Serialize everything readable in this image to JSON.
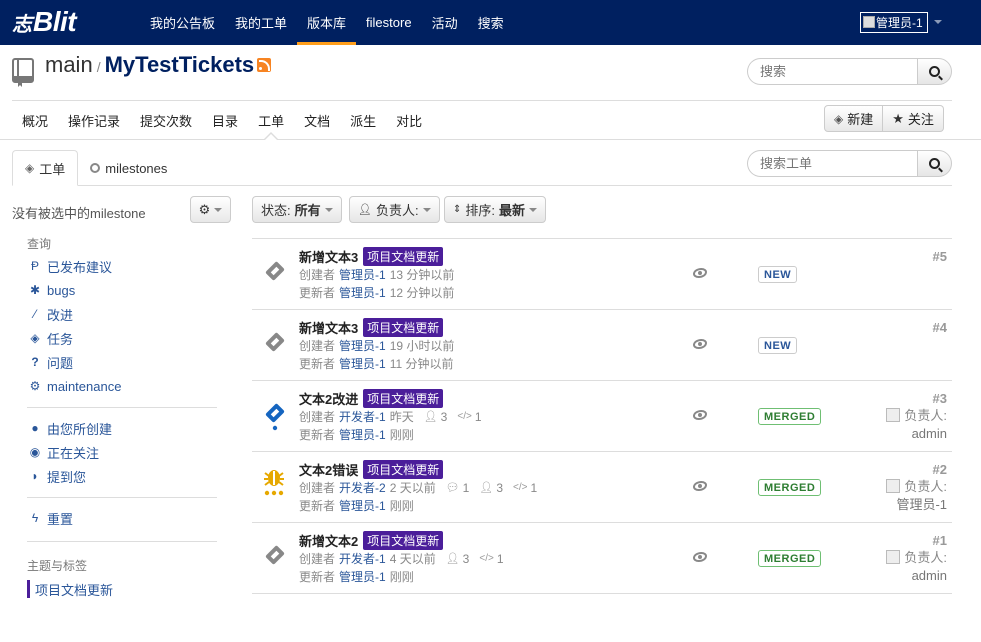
{
  "brand": {
    "prefix": "志",
    "name": "Blit"
  },
  "nav": [
    "我的公告板",
    "我的工单",
    "版本库",
    "filestore",
    "活动",
    "搜索"
  ],
  "nav_active_index": 2,
  "user": {
    "avatar_alt": "管理员-1"
  },
  "repo": {
    "project": "main",
    "separator": "/",
    "name": "MyTestTickets"
  },
  "search": {
    "placeholder": "搜索"
  },
  "subnav": [
    "概况",
    "操作记录",
    "提交次数",
    "目录",
    "工单",
    "文档",
    "派生",
    "对比"
  ],
  "subnav_active_index": 4,
  "actions": {
    "new_label": "新建",
    "watch_label": "关注"
  },
  "tabs": {
    "tickets": "工单",
    "milestones": "milestones"
  },
  "ticket_search": {
    "placeholder": "搜索工单"
  },
  "sidebar": {
    "no_milestone": "没有被选中的milestone",
    "query_heading": "查询",
    "queries": [
      {
        "icon": "proposal-icon",
        "label": "已发布建议"
      },
      {
        "icon": "bug-icon",
        "label": "bugs"
      },
      {
        "icon": "wand-icon",
        "label": "改进"
      },
      {
        "icon": "task-icon",
        "label": "任务"
      },
      {
        "icon": "question-icon",
        "label": "问题"
      },
      {
        "icon": "cogs-icon",
        "label": "maintenance"
      }
    ],
    "personal": [
      {
        "icon": "user-icon",
        "label": "由您所创建"
      },
      {
        "icon": "eye-icon",
        "label": "正在关注"
      },
      {
        "icon": "comment-icon",
        "label": "提到您"
      }
    ],
    "reset": "重置",
    "topics_heading": "主题与标签",
    "topic": "项目文档更新"
  },
  "filters": {
    "status_label": "状态:",
    "status_value": "所有",
    "responsible_label": "负责人:",
    "sort_label": "排序:",
    "sort_value": "最新"
  },
  "labels": {
    "created_by": "创建者",
    "updated_by": "更新者",
    "responsible": "负责人:"
  },
  "colors": {
    "nav_bg": "#002060",
    "nav_active": "#ff9e1b",
    "topic": "#4b1e9a",
    "link": "#2a5699",
    "merged": "#2e7d32"
  },
  "tickets": [
    {
      "type": "request-icon",
      "title": "新增文本3",
      "topic": "项目文档更新",
      "creator": "管理员-1",
      "created": "13 分钟以前",
      "updater": "管理员-1",
      "updated": "12 分钟以前",
      "status": "NEW",
      "number": "#5",
      "comments": "",
      "participants": "",
      "patchsets": "",
      "responsible": ""
    },
    {
      "type": "request-icon",
      "title": "新增文本3",
      "topic": "项目文档更新",
      "creator": "管理员-1",
      "created": "19 小时以前",
      "updater": "管理员-1",
      "updated": "11 分钟以前",
      "status": "NEW",
      "number": "#4",
      "comments": "",
      "participants": "",
      "patchsets": "",
      "responsible": ""
    },
    {
      "type": "enhancement-icon",
      "title": "文本2改进",
      "topic": "项目文档更新",
      "creator": "开发者-1",
      "created": "昨天",
      "updater": "管理员-1",
      "updated": "刚刚",
      "status": "MERGED",
      "number": "#3",
      "comments": "",
      "participants": "3",
      "patchsets": "1",
      "responsible": "admin"
    },
    {
      "type": "bug-icon",
      "title": "文本2错误",
      "topic": "项目文档更新",
      "creator": "开发者-2",
      "created": "2 天以前",
      "updater": "管理员-1",
      "updated": "刚刚",
      "status": "MERGED",
      "number": "#2",
      "comments": "1",
      "participants": "3",
      "patchsets": "1",
      "responsible": "管理员-1"
    },
    {
      "type": "request-icon",
      "title": "新增文本2",
      "topic": "项目文档更新",
      "creator": "开发者-1",
      "created": "4 天以前",
      "updater": "管理员-1",
      "updated": "刚刚",
      "status": "MERGED",
      "number": "#1",
      "comments": "",
      "participants": "3",
      "patchsets": "1",
      "responsible": "admin"
    }
  ]
}
